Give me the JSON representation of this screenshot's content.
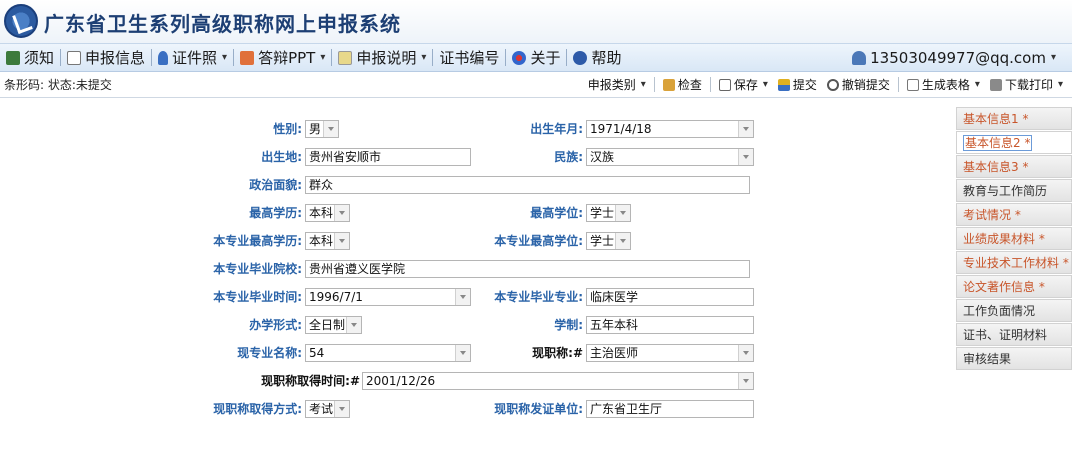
{
  "header": {
    "title": "广东省卫生系列高级职称网上申报系统"
  },
  "menu": {
    "items": [
      {
        "label": "须知"
      },
      {
        "label": "申报信息"
      },
      {
        "label": "证件照",
        "caret": "▾"
      },
      {
        "label": "答辩PPT",
        "caret": "▾"
      },
      {
        "label": "申报说明",
        "caret": "▾"
      },
      {
        "label": "证书编号"
      },
      {
        "label": "关于"
      },
      {
        "label": "帮助"
      }
    ],
    "user": "13503049977@qq.com",
    "user_caret": "▾"
  },
  "toolbar": {
    "status": "条形码: 状态:未提交",
    "tools": {
      "category": "申报类别",
      "check": "检查",
      "save": "保存",
      "submit": "提交",
      "withdraw": "撤销提交",
      "generate": "生成表格",
      "download": "下载打印"
    },
    "caret": "▾"
  },
  "nav": {
    "items": [
      "基本信息1 *",
      "基本信息2 *",
      "基本信息3 *",
      "教育与工作简历",
      "考试情况 *",
      "业绩成果材料 *",
      "专业技术工作材料 *",
      "论文著作信息 *",
      "工作负面情况",
      "证书、证明材料",
      "审核结果"
    ]
  },
  "form": {
    "gender": {
      "label": "性别:",
      "value": "男"
    },
    "birth": {
      "label": "出生年月:",
      "value": "1971/4/18"
    },
    "birthplace": {
      "label": "出生地:",
      "value": "贵州省安顺市"
    },
    "ethnicity": {
      "label": "民族:",
      "value": "汉族"
    },
    "political": {
      "label": "政治面貌:",
      "value": "群众"
    },
    "edu": {
      "label": "最高学历:",
      "value": "本科"
    },
    "degree": {
      "label": "最高学位:",
      "value": "学士"
    },
    "major_edu": {
      "label": "本专业最高学历:",
      "value": "本科"
    },
    "major_degree": {
      "label": "本专业最高学位:",
      "value": "学士"
    },
    "school": {
      "label": "本专业毕业院校:",
      "value": "贵州省遵义医学院"
    },
    "grad_time": {
      "label": "本专业毕业时间:",
      "value": "1996/7/1"
    },
    "grad_major": {
      "label": "本专业毕业专业:",
      "value": "临床医学"
    },
    "study_form": {
      "label": "办学形式:",
      "value": "全日制"
    },
    "length": {
      "label": "学制:",
      "value": "五年本科"
    },
    "cur_major": {
      "label": "现专业名称:",
      "value": "54"
    },
    "cur_title": {
      "label": "现职称:#",
      "value": "主治医师"
    },
    "title_time": {
      "label": "现职称取得时间:#",
      "value": "2001/12/26"
    },
    "title_way": {
      "label": "现职称取得方式:",
      "value": "考试"
    },
    "issuer": {
      "label": "现职称发证单位:",
      "value": "广东省卫生厅"
    }
  },
  "colors": {
    "label_blue": "#2a63a8",
    "required_orange": "#c8552a",
    "title_navy": "#1d3f74"
  }
}
